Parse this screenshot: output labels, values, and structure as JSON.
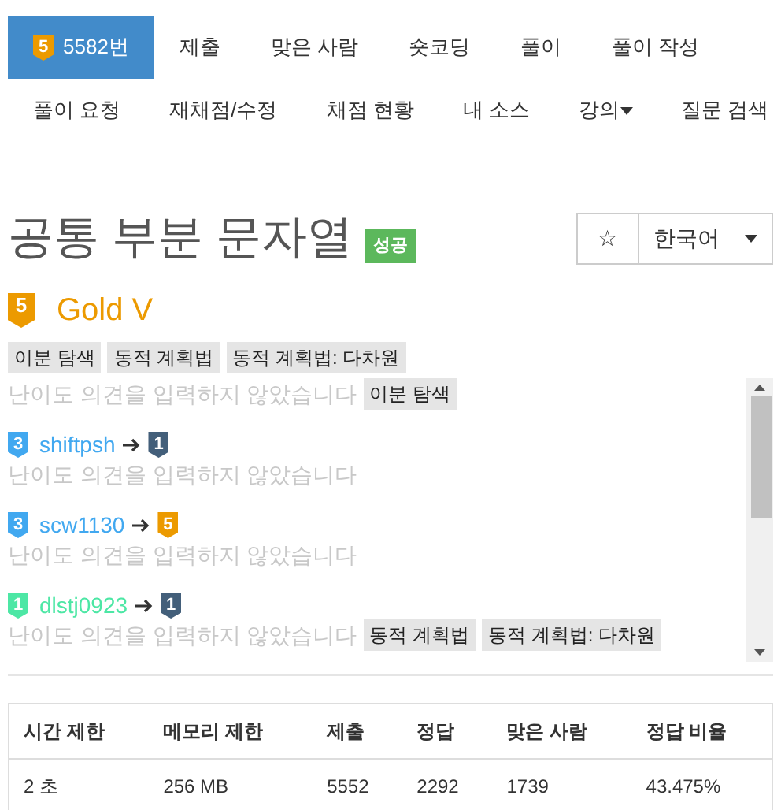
{
  "nav_primary": [
    {
      "label": "5582번",
      "selected": true,
      "tier": {
        "badge": "5",
        "color": "#ec9a00"
      }
    },
    {
      "label": "제출",
      "selected": false
    },
    {
      "label": "맞은 사람",
      "selected": false
    },
    {
      "label": "숏코딩",
      "selected": false
    },
    {
      "label": "풀이",
      "selected": false
    },
    {
      "label": "풀이 작성",
      "selected": false
    }
  ],
  "nav_secondary": [
    {
      "label": "풀이 요청",
      "dropdown": false
    },
    {
      "label": "재채점/수정",
      "dropdown": false
    },
    {
      "label": "채점 현황",
      "dropdown": false
    },
    {
      "label": "내 소스",
      "dropdown": false
    },
    {
      "label": "강의",
      "dropdown": true
    },
    {
      "label": "질문 검색",
      "dropdown": false
    }
  ],
  "title": "공통 부분 문자열",
  "result_label": "성공",
  "favorite_button": "☆",
  "language_select": "한국어",
  "tier": {
    "badge": "5",
    "name": "Gold V",
    "color": "#ec9a00"
  },
  "tags": [
    "이분 탐색",
    "동적 계획법",
    "동적 계획법: 다차원"
  ],
  "opinions": [
    {
      "comment": "난이도 의견을 입력하지 않았습니다",
      "tags": [
        "이분 탐색"
      ]
    },
    {
      "from": {
        "badge": "3",
        "color": "#41a8f0"
      },
      "user": "shiftpsh",
      "to": {
        "badge": "1",
        "color": "#435f7a"
      },
      "comment": "난이도 의견을 입력하지 않았습니다"
    },
    {
      "from": {
        "badge": "3",
        "color": "#41a8f0"
      },
      "user": "scw1130",
      "to": {
        "badge": "5",
        "color": "#ec9a00"
      },
      "comment": "난이도 의견을 입력하지 않았습니다"
    },
    {
      "from": {
        "badge": "1",
        "color": "#4de7a5"
      },
      "user": "dlstj0923",
      "to": {
        "badge": "1",
        "color": "#435f7a"
      },
      "comment": "난이도 의견을 입력하지 않았습니다",
      "tags": [
        "동적 계획법",
        "동적 계획법: 다차원"
      ]
    }
  ],
  "table": {
    "columns": [
      "시간 제한",
      "메모리 제한",
      "제출",
      "정답",
      "맞은 사람",
      "정답 비율"
    ],
    "rows": [
      [
        "2 초",
        "256 MB",
        "5552",
        "2292",
        "1739",
        "43.475%"
      ]
    ]
  }
}
